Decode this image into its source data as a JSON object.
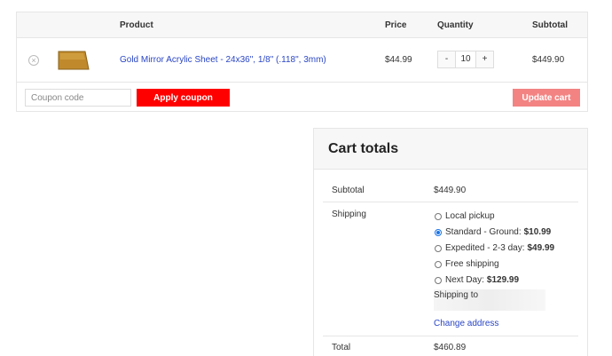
{
  "cart": {
    "headers": {
      "product": "Product",
      "price": "Price",
      "quantity": "Quantity",
      "subtotal": "Subtotal"
    },
    "item": {
      "name": "Gold Mirror Acrylic Sheet - 24x36\", 1/8\" (.118\", 3mm)",
      "price": "$44.99",
      "quantity": "10",
      "subtotal": "$449.90",
      "qty_minus": "-",
      "qty_plus": "+",
      "remove_symbol": "×"
    },
    "coupon_placeholder": "Coupon code",
    "apply_label": "Apply coupon",
    "update_label": "Update cart"
  },
  "totals": {
    "title": "Cart totals",
    "subtotal_label": "Subtotal",
    "subtotal_value": "$449.90",
    "shipping_label": "Shipping",
    "shipping_options": [
      {
        "label": "Local pickup",
        "price": "",
        "checked": false
      },
      {
        "label": "Standard - Ground:",
        "price": "$10.99",
        "checked": true
      },
      {
        "label": "Expedited - 2-3 day:",
        "price": "$49.99",
        "checked": false
      },
      {
        "label": "Free shipping",
        "price": "",
        "checked": false
      },
      {
        "label": "Next Day:",
        "price": "$129.99",
        "checked": false
      }
    ],
    "shipping_to": "Shipping to",
    "change_address": "Change address",
    "total_label": "Total",
    "total_value": "$460.89"
  },
  "colors": {
    "apply_button": "#ff0000",
    "update_button": "#f38383",
    "link": "#2a46c5",
    "radio_accent": "#1a73e8"
  }
}
